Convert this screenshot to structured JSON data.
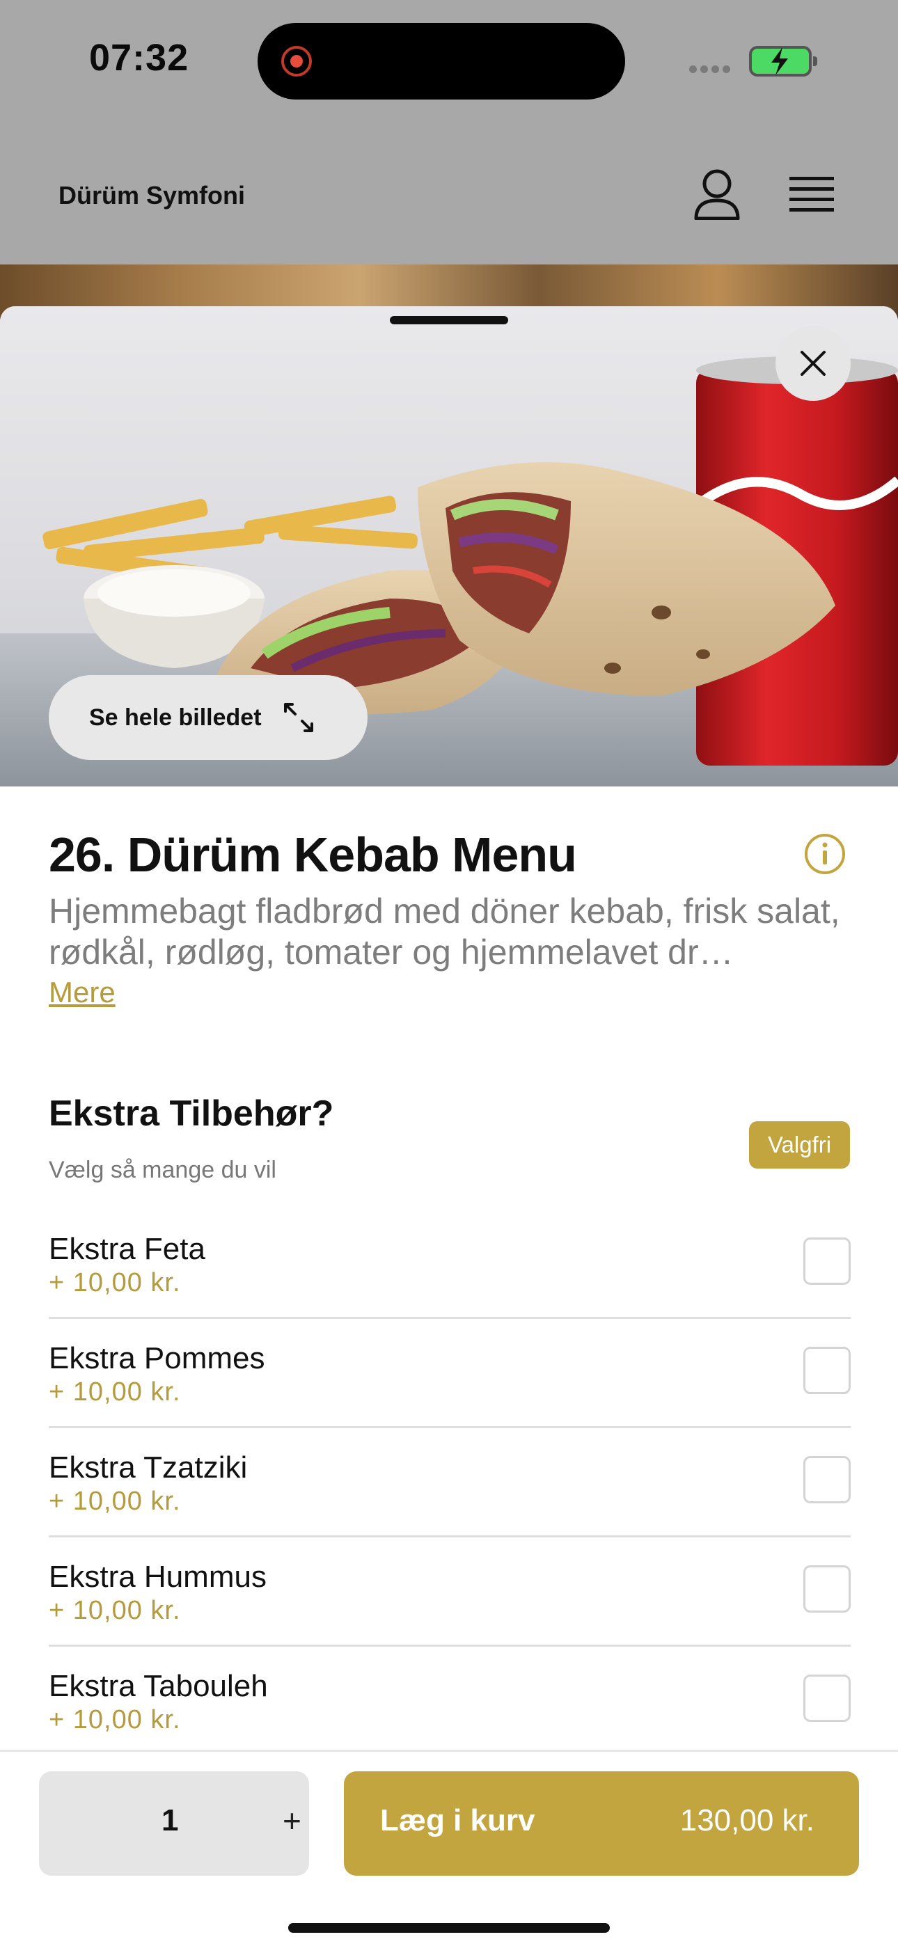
{
  "status_bar": {
    "time": "07:32"
  },
  "header": {
    "brand": "Dürüm Symfoni"
  },
  "hero": {
    "full_image_label": "Se hele billedet"
  },
  "product": {
    "title": "26. Dürüm Kebab Menu",
    "description": "Hjemmebagt fladbrød med döner kebab, frisk salat, rødkål, rødløg, tomater og hjemmelavet dr…",
    "more_label": "Mere"
  },
  "extras": {
    "title": "Ekstra Tilbehør?",
    "subtitle": "Vælg så mange du vil",
    "badge": "Valgfri",
    "options": [
      {
        "name": "Ekstra Feta",
        "price": "+ 10,00 kr."
      },
      {
        "name": "Ekstra Pommes",
        "price": "+ 10,00 kr."
      },
      {
        "name": "Ekstra Tzatziki",
        "price": "+ 10,00 kr."
      },
      {
        "name": "Ekstra Hummus",
        "price": "+ 10,00 kr."
      },
      {
        "name": "Ekstra Tabouleh",
        "price": "+ 10,00 kr."
      }
    ]
  },
  "cart": {
    "quantity": "1",
    "plus_label": "+",
    "add_label": "Læg i kurv",
    "total": "130,00 kr."
  },
  "colors": {
    "accent": "#c2a53f",
    "price": "#b59b3b",
    "scrim": "#a8a8a8"
  }
}
